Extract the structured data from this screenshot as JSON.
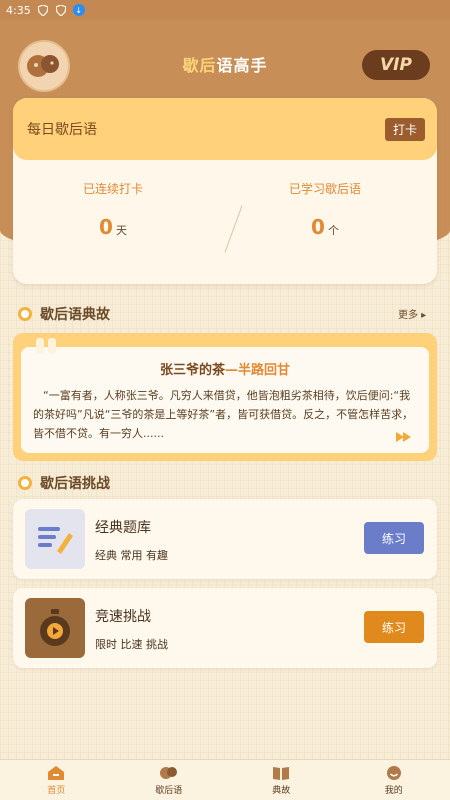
{
  "status_bar": {
    "time": "4:35"
  },
  "header": {
    "title_part1": "歇后",
    "title_part2": "语高手",
    "vip_label": "VIP",
    "colors": {
      "header_bg": "#c78e57",
      "accent": "#e08a34"
    }
  },
  "daily": {
    "title": "每日歇后语",
    "checkin_label": "打卡",
    "streak_label": "已连续打卡",
    "streak_value": "0",
    "streak_unit": "天",
    "learned_label": "已学习歇后语",
    "learned_value": "0",
    "learned_unit": "个"
  },
  "story_section": {
    "title": "歇后语典故",
    "more_label": "更多 ▸",
    "story_title_part1": "张三爷的茶",
    "story_title_part2": "—半路回甘",
    "story_text": "“一富有者，人称张三爷。凡穷人来借贷，他皆泡粗劣茶相待，饮后便问:“我的茶好吗”凡说“三爷的茶是上等好茶”者，皆可获借贷。反之，不管怎样苦求，皆不借不贷。有一穷人......"
  },
  "challenge_section": {
    "title": "歇后语挑战",
    "items": [
      {
        "name": "经典题库",
        "tags": "经典 常用 有趣",
        "button": "练习",
        "button_color": "#6b7cc9",
        "icon": "pencil-list-icon"
      },
      {
        "name": "竞速挑战",
        "tags": "限时 比速 挑战",
        "button": "练习",
        "button_color": "#e08a1e",
        "icon": "stopwatch-icon"
      }
    ]
  },
  "bottom_nav": {
    "items": [
      {
        "label": "首页",
        "icon": "home-icon",
        "active": true
      },
      {
        "label": "歇后语",
        "icon": "chat-icon",
        "active": false
      },
      {
        "label": "典故",
        "icon": "book-icon",
        "active": false
      },
      {
        "label": "我的",
        "icon": "smile-icon",
        "active": false
      }
    ]
  }
}
